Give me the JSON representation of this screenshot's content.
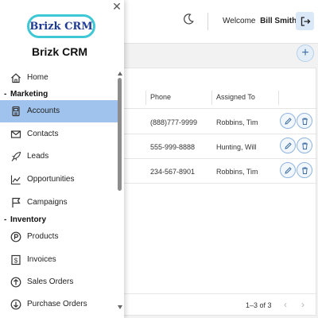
{
  "header": {
    "welcome": "Welcome",
    "user_name": "Bill Smith",
    "theme_icon": "moon-icon",
    "logout_icon": "logout-icon",
    "add_icon": "plus-icon"
  },
  "table": {
    "columns": [
      "Phone",
      "Assigned To"
    ],
    "rows": [
      {
        "phone": "(888)777-9999",
        "assigned": "Robbins, Tim"
      },
      {
        "phone": "555-999-8888",
        "assigned": "Hunting, Will"
      },
      {
        "phone": "234-567-8901",
        "assigned": "Robbins, Tim"
      }
    ],
    "pagination": "1–3 of 3",
    "prev_icon": "chevron-left-icon",
    "next_icon": "chevron-right-icon"
  },
  "drawer": {
    "logo_text": "Brizk CRM",
    "brand": "Brizk CRM",
    "close_icon": "close-icon",
    "items": [
      {
        "label": "Home",
        "icon": "home-icon"
      },
      {
        "section": "Marketing"
      },
      {
        "label": "Accounts",
        "icon": "accounts-icon",
        "active": true
      },
      {
        "label": "Contacts",
        "icon": "mail-icon"
      },
      {
        "label": "Leads",
        "icon": "rocket-icon"
      },
      {
        "label": "Opportunities",
        "icon": "chart-line-icon"
      },
      {
        "label": "Campaigns",
        "icon": "flag-icon"
      },
      {
        "section": "Inventory"
      },
      {
        "label": "Products",
        "icon": "products-icon"
      },
      {
        "label": "Invoices",
        "icon": "invoice-icon"
      },
      {
        "label": "Sales Orders",
        "icon": "arrow-up-circle-icon"
      },
      {
        "label": "Purchase Orders",
        "icon": "arrow-down-circle-icon"
      }
    ],
    "section_marker": "-"
  },
  "colors": {
    "active_item": "#9fc3ec",
    "logo_border": "#3ec8d6",
    "logo_text": "#1f3a93",
    "action_border": "#8fb4de"
  }
}
